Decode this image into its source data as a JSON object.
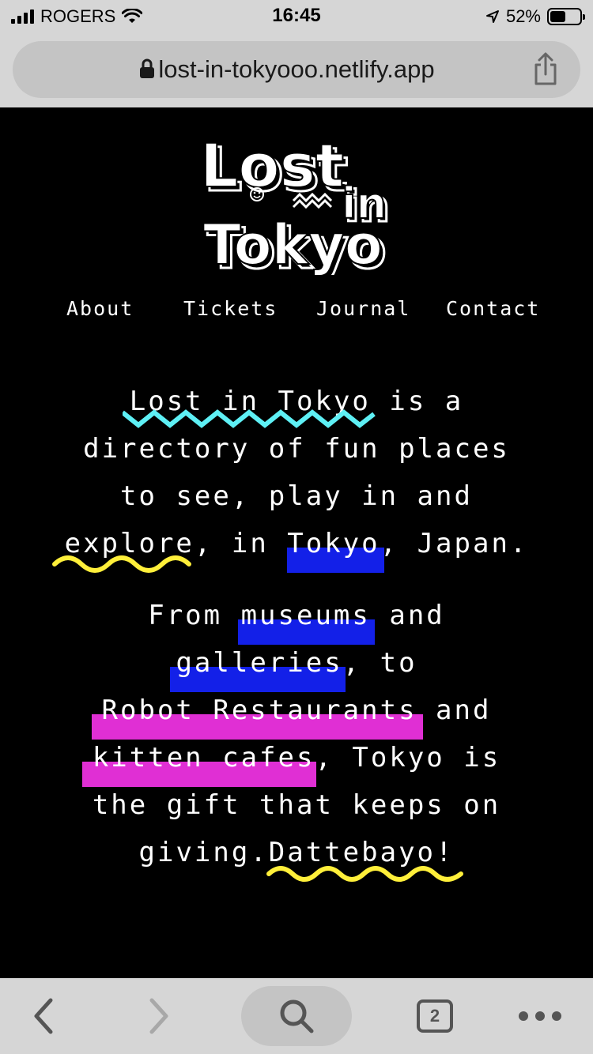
{
  "status_bar": {
    "carrier": "ROGERS",
    "time": "16:45",
    "battery_percent": "52%",
    "battery_level": 0.52
  },
  "browser": {
    "url": "lost-in-tokyooo.netlify.app",
    "tabs_count": "2"
  },
  "logo": {
    "line1": "Lost",
    "line2": "in",
    "line3": "Tokyo"
  },
  "nav": {
    "items": [
      {
        "label": "About"
      },
      {
        "label": "Tickets"
      },
      {
        "label": "Journal"
      },
      {
        "label": "Contact"
      }
    ]
  },
  "intro": {
    "l1_link": "Lost in Tokyo",
    "l1_rest": " is a",
    "l2": "directory of fun places",
    "l3": "to see, play in and",
    "l4_link": "explore",
    "l4_mid": ", in ",
    "l4_tokyo": "Tokyo",
    "l4_end": ", Japan."
  },
  "body": {
    "l1_start": "From ",
    "l1_museums": "museums",
    "l1_end": " and",
    "l2_galleries": "galleries",
    "l2_end": ", to",
    "l3_robot": "Robot Restaurants",
    "l3_end": " and",
    "l4_kitten": "kitten cafes",
    "l4_end": ", Tokyo is",
    "l5": "the gift that keeps on",
    "l6_start": "giving.",
    "l6_link": "Dattebayo!"
  },
  "colors": {
    "squiggle_cyan": "#5ef0f5",
    "squiggle_yellow": "#ffef3a",
    "highlight_blue": "#1320e8",
    "highlight_pink": "#e02fd4"
  }
}
